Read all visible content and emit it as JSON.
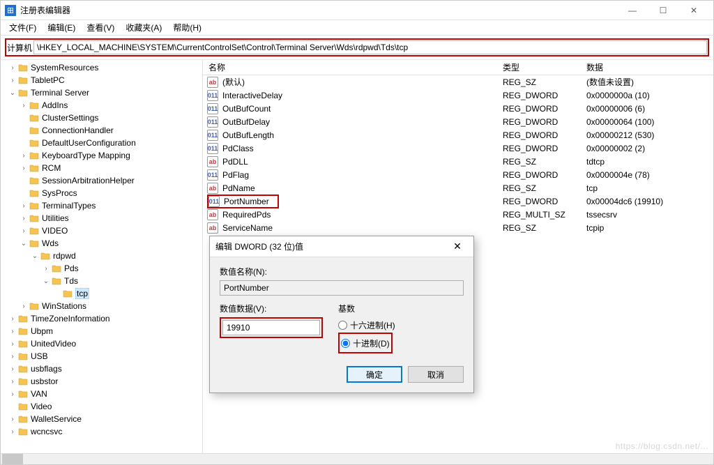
{
  "titlebar": {
    "title": "注册表编辑器"
  },
  "menu": {
    "file": "文件(F)",
    "edit": "编辑(E)",
    "view": "查看(V)",
    "fav": "收藏夹(A)",
    "help": "帮助(H)"
  },
  "address": {
    "label": "计算机",
    "path": "\\HKEY_LOCAL_MACHINE\\SYSTEM\\CurrentControlSet\\Control\\Terminal Server\\Wds\\rdpwd\\Tds\\tcp"
  },
  "columns": {
    "name": "名称",
    "type": "类型",
    "data": "数据"
  },
  "tree": [
    {
      "depth": 4,
      "tw": ">",
      "label": "SystemResources"
    },
    {
      "depth": 4,
      "tw": ">",
      "label": "TabletPC"
    },
    {
      "depth": 4,
      "tw": "v",
      "label": "Terminal Server"
    },
    {
      "depth": 5,
      "tw": ">",
      "label": "AddIns"
    },
    {
      "depth": 5,
      "tw": "",
      "label": "ClusterSettings"
    },
    {
      "depth": 5,
      "tw": "",
      "label": "ConnectionHandler"
    },
    {
      "depth": 5,
      "tw": "",
      "label": "DefaultUserConfiguration"
    },
    {
      "depth": 5,
      "tw": ">",
      "label": "KeyboardType Mapping"
    },
    {
      "depth": 5,
      "tw": ">",
      "label": "RCM"
    },
    {
      "depth": 5,
      "tw": "",
      "label": "SessionArbitrationHelper"
    },
    {
      "depth": 5,
      "tw": "",
      "label": "SysProcs"
    },
    {
      "depth": 5,
      "tw": ">",
      "label": "TerminalTypes"
    },
    {
      "depth": 5,
      "tw": ">",
      "label": "Utilities"
    },
    {
      "depth": 5,
      "tw": ">",
      "label": "VIDEO"
    },
    {
      "depth": 5,
      "tw": "v",
      "label": "Wds"
    },
    {
      "depth": 6,
      "tw": "v",
      "label": "rdpwd"
    },
    {
      "depth": 7,
      "tw": ">",
      "label": "Pds"
    },
    {
      "depth": 7,
      "tw": "v",
      "label": "Tds"
    },
    {
      "depth": 8,
      "tw": "",
      "label": "tcp",
      "selected": true
    },
    {
      "depth": 5,
      "tw": ">",
      "label": "WinStations"
    },
    {
      "depth": 4,
      "tw": ">",
      "label": "TimeZoneInformation"
    },
    {
      "depth": 4,
      "tw": ">",
      "label": "Ubpm"
    },
    {
      "depth": 4,
      "tw": ">",
      "label": "UnitedVideo"
    },
    {
      "depth": 4,
      "tw": ">",
      "label": "USB"
    },
    {
      "depth": 4,
      "tw": ">",
      "label": "usbflags"
    },
    {
      "depth": 4,
      "tw": ">",
      "label": "usbstor"
    },
    {
      "depth": 4,
      "tw": ">",
      "label": "VAN"
    },
    {
      "depth": 4,
      "tw": "",
      "label": "Video"
    },
    {
      "depth": 4,
      "tw": ">",
      "label": "WalletService"
    },
    {
      "depth": 4,
      "tw": ">",
      "label": "wcncsvc"
    }
  ],
  "values": [
    {
      "icon": "sz",
      "name": "(默认)",
      "type": "REG_SZ",
      "data": "(数值未设置)"
    },
    {
      "icon": "dw",
      "name": "InteractiveDelay",
      "type": "REG_DWORD",
      "data": "0x0000000a (10)"
    },
    {
      "icon": "dw",
      "name": "OutBufCount",
      "type": "REG_DWORD",
      "data": "0x00000006 (6)"
    },
    {
      "icon": "dw",
      "name": "OutBufDelay",
      "type": "REG_DWORD",
      "data": "0x00000064 (100)"
    },
    {
      "icon": "dw",
      "name": "OutBufLength",
      "type": "REG_DWORD",
      "data": "0x00000212 (530)"
    },
    {
      "icon": "dw",
      "name": "PdClass",
      "type": "REG_DWORD",
      "data": "0x00000002 (2)"
    },
    {
      "icon": "sz",
      "name": "PdDLL",
      "type": "REG_SZ",
      "data": "tdtcp"
    },
    {
      "icon": "dw",
      "name": "PdFlag",
      "type": "REG_DWORD",
      "data": "0x0000004e (78)"
    },
    {
      "icon": "sz",
      "name": "PdName",
      "type": "REG_SZ",
      "data": "tcp"
    },
    {
      "icon": "dw",
      "name": "PortNumber",
      "type": "REG_DWORD",
      "data": "0x00004dc6 (19910)",
      "highlight": true
    },
    {
      "icon": "sz",
      "name": "RequiredPds",
      "type": "REG_MULTI_SZ",
      "data": "tssecsrv"
    },
    {
      "icon": "sz",
      "name": "ServiceName",
      "type": "REG_SZ",
      "data": "tcpip"
    }
  ],
  "dialog": {
    "title": "编辑 DWORD (32 位)值",
    "name_label": "数值名称(N):",
    "name_value": "PortNumber",
    "data_label": "数值数据(V):",
    "data_value": "19910",
    "base_label": "基数",
    "radio_hex": "十六进制(H)",
    "radio_dec": "十进制(D)",
    "ok": "确定",
    "cancel": "取消"
  },
  "watermark": "https://blog.csdn.net/..."
}
